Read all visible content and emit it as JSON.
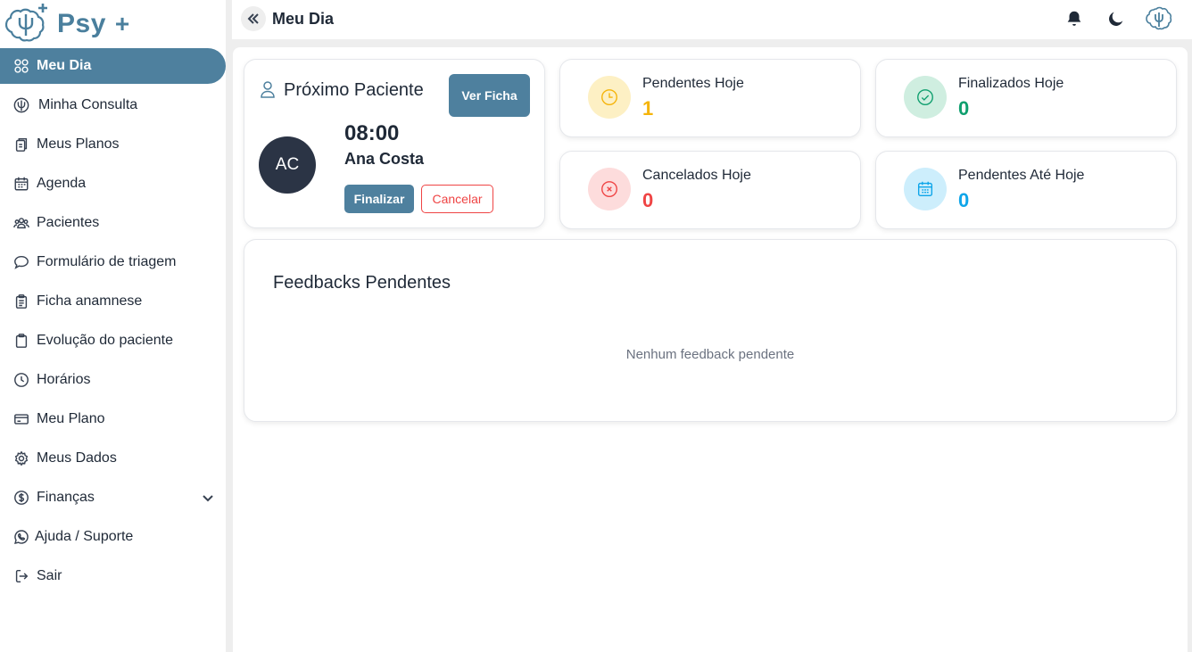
{
  "app": {
    "name": "Psy",
    "plus": "+"
  },
  "header": {
    "title": "Meu Dia"
  },
  "colors": {
    "primary": "#4e809e",
    "danger": "#ef4444",
    "warning": "#f5b40a",
    "success": "#0f9f6e",
    "info": "#0ea5e9"
  },
  "sidebar": {
    "items": [
      {
        "label": "Meu Dia",
        "icon": "grid-icon"
      },
      {
        "label": "Minha Consulta",
        "icon": "psi-icon"
      },
      {
        "label": "Meus Planos",
        "icon": "documents-icon"
      },
      {
        "label": "Agenda",
        "icon": "calendar-icon"
      },
      {
        "label": "Pacientes",
        "icon": "users-icon"
      },
      {
        "label": "Formulário de triagem",
        "icon": "chat-bubble-icon"
      },
      {
        "label": "Ficha anamnese",
        "icon": "clipboard-list-icon"
      },
      {
        "label": "Evolução do paciente",
        "icon": "clipboard-icon"
      },
      {
        "label": "Horários",
        "icon": "clock-icon"
      },
      {
        "label": "Meu Plano",
        "icon": "credit-card-icon"
      },
      {
        "label": "Meus Dados",
        "icon": "gear-icon"
      },
      {
        "label": "Finanças",
        "icon": "dollar-circle-icon"
      },
      {
        "label": "Ajuda / Suporte",
        "icon": "whatsapp-icon"
      },
      {
        "label": "Sair",
        "icon": "logout-icon"
      }
    ]
  },
  "next_patient": {
    "title": "Próximo Paciente",
    "view_button": "Ver Ficha",
    "initials": "AC",
    "time": "08:00",
    "name": "Ana Costa",
    "finish_button": "Finalizar",
    "cancel_button": "Cancelar"
  },
  "stats": {
    "pending_today": {
      "label": "Pendentes Hoje",
      "value": "1"
    },
    "finished_today": {
      "label": "Finalizados Hoje",
      "value": "0"
    },
    "cancelled_today": {
      "label": "Cancelados Hoje",
      "value": "0"
    },
    "pending_until_today": {
      "label": "Pendentes Até Hoje",
      "value": "0"
    }
  },
  "feedbacks": {
    "title": "Feedbacks Pendentes",
    "empty": "Nenhum feedback pendente"
  }
}
